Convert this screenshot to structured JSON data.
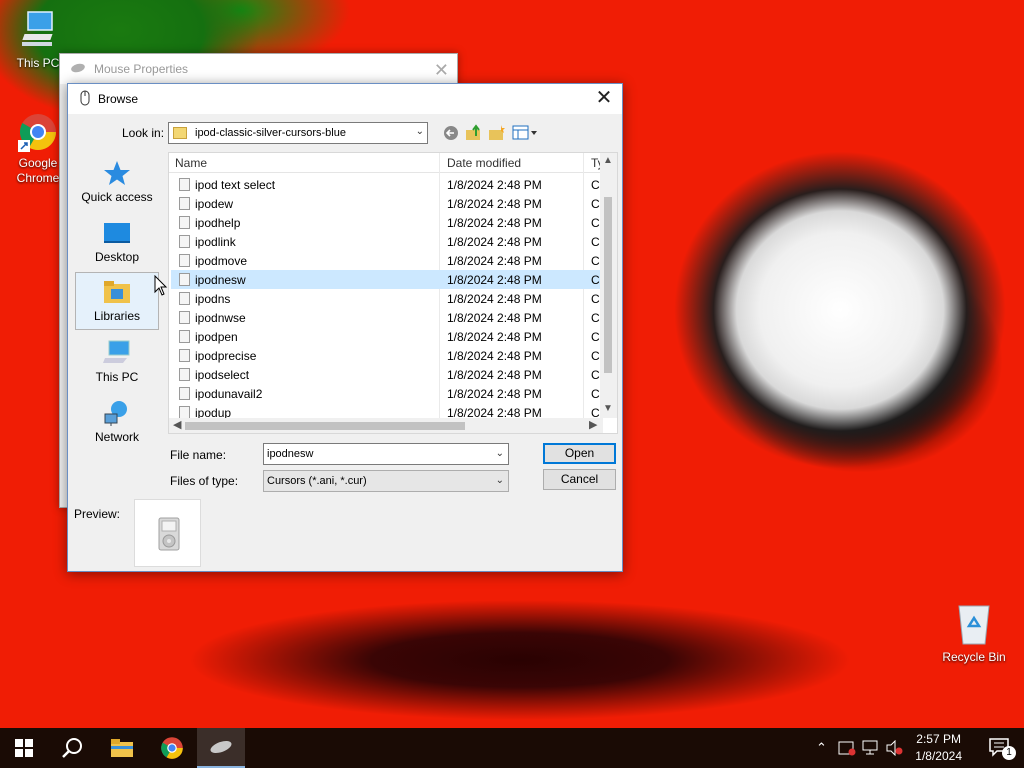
{
  "desktop": {
    "icons": [
      {
        "label": "This PC"
      },
      {
        "label": "Google Chrome"
      },
      {
        "label": "Recycle Bin"
      }
    ]
  },
  "mouse_window": {
    "title": "Mouse Properties",
    "close_label": "✕"
  },
  "browse": {
    "title": "Browse",
    "close_label": "✕",
    "look_in_label": "Look in:",
    "look_in_value": "ipod-classic-silver-cursors-blue",
    "places": [
      {
        "label": "Quick access"
      },
      {
        "label": "Desktop"
      },
      {
        "label": "Libraries"
      },
      {
        "label": "This PC"
      },
      {
        "label": "Network"
      }
    ],
    "columns": {
      "name": "Name",
      "date": "Date modified",
      "type": "Ty"
    },
    "files": [
      {
        "name": "ipod text select",
        "date": "1/8/2024 2:48 PM",
        "type": "Cu"
      },
      {
        "name": "ipodew",
        "date": "1/8/2024 2:48 PM",
        "type": "Cu"
      },
      {
        "name": "ipodhelp",
        "date": "1/8/2024 2:48 PM",
        "type": "Cu"
      },
      {
        "name": "ipodlink",
        "date": "1/8/2024 2:48 PM",
        "type": "Cu"
      },
      {
        "name": "ipodmove",
        "date": "1/8/2024 2:48 PM",
        "type": "Cu"
      },
      {
        "name": "ipodnesw",
        "date": "1/8/2024 2:48 PM",
        "type": "Cu",
        "selected": true
      },
      {
        "name": "ipodns",
        "date": "1/8/2024 2:48 PM",
        "type": "Cu"
      },
      {
        "name": "ipodnwse",
        "date": "1/8/2024 2:48 PM",
        "type": "Cu"
      },
      {
        "name": "ipodpen",
        "date": "1/8/2024 2:48 PM",
        "type": "Cu"
      },
      {
        "name": "ipodprecise",
        "date": "1/8/2024 2:48 PM",
        "type": "Cu"
      },
      {
        "name": "ipodselect",
        "date": "1/8/2024 2:48 PM",
        "type": "Cu"
      },
      {
        "name": "ipodunavail2",
        "date": "1/8/2024 2:48 PM",
        "type": "Cu"
      },
      {
        "name": "ipodup",
        "date": "1/8/2024 2:48 PM",
        "type": "Cu"
      }
    ],
    "file_name_label": "File name:",
    "file_name_value": "ipodnesw",
    "file_type_label": "Files of type:",
    "file_type_value": "Cursors (*.ani, *.cur)",
    "open_label": "Open",
    "cancel_label": "Cancel",
    "preview_label": "Preview:"
  },
  "taskbar": {
    "time": "2:57 PM",
    "date": "1/8/2024",
    "notification_count": "1"
  }
}
